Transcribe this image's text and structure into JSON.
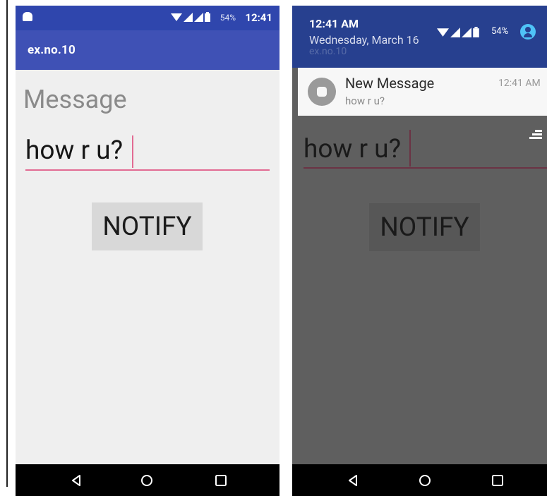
{
  "left_screen": {
    "status_bar": {
      "battery_pct": "54%",
      "time": "12:41"
    },
    "app_bar": {
      "title": "ex.no.10"
    },
    "message_label": "Message",
    "message_input": {
      "value": "how r u?"
    },
    "notify_button": "NOTIFY"
  },
  "right_screen": {
    "shade": {
      "time": "12:41 AM",
      "date": "Wednesday, March 16",
      "ghost_title": "ex.no.10",
      "battery_pct": "54%"
    },
    "notification": {
      "title": "New Message",
      "body": "how r u?",
      "time": "12:41 AM"
    },
    "message_input": {
      "value": "how r u?"
    },
    "notify_button": "NOTIFY"
  },
  "colors": {
    "primary": "#3f51b5",
    "primary_dark": "#2f46ad",
    "accent": "#e26b93",
    "background": "#efefef",
    "dim_overlay": "#5f5f5f",
    "navbar": "#000000"
  },
  "icons": [
    "notification-icon",
    "wifi-icon",
    "signal-icon",
    "battery-icon",
    "user-icon",
    "back-icon",
    "home-icon",
    "recents-icon",
    "clear-all-icon"
  ]
}
